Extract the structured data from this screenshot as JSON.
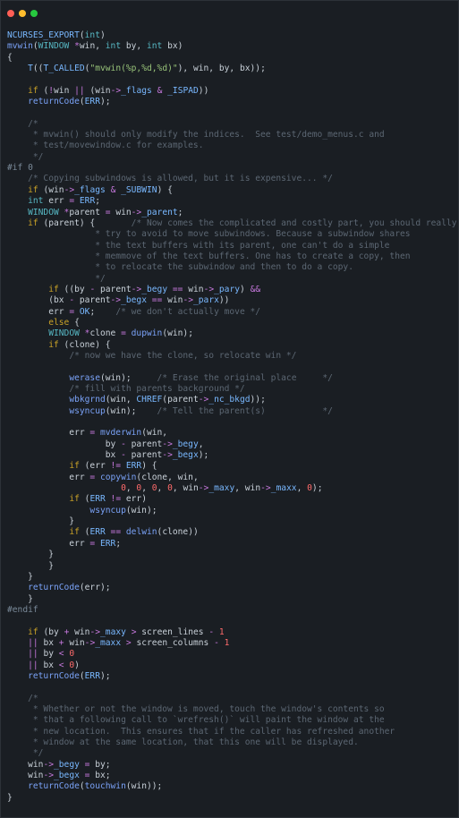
{
  "window": {
    "controls": [
      {
        "name": "close",
        "color": "#ff5f56"
      },
      {
        "name": "minimize",
        "color": "#ffbd2e"
      },
      {
        "name": "zoom",
        "color": "#27c93f"
      }
    ]
  },
  "code_lines": [
    [
      [
        "m",
        "NCURSES_EXPORT"
      ],
      [
        "d",
        "("
      ],
      [
        "t",
        "int"
      ],
      [
        "d",
        ")"
      ]
    ],
    [
      [
        "f",
        "mvwin"
      ],
      [
        "d",
        "("
      ],
      [
        "t",
        "WINDOW"
      ],
      [
        "d",
        " "
      ],
      [
        "o",
        "*"
      ],
      [
        "d",
        "win, "
      ],
      [
        "t",
        "int"
      ],
      [
        "d",
        " by, "
      ],
      [
        "t",
        "int"
      ],
      [
        "d",
        " bx)"
      ]
    ],
    [
      [
        "d",
        "{"
      ]
    ],
    [
      [
        "d",
        "    "
      ],
      [
        "m",
        "T"
      ],
      [
        "d",
        "(("
      ],
      [
        "m",
        "T_CALLED"
      ],
      [
        "d",
        "("
      ],
      [
        "s",
        "\"mvwin(%p,%d,%d)\""
      ],
      [
        "d",
        "), win, by, bx));"
      ]
    ],
    [
      [
        "d",
        ""
      ]
    ],
    [
      [
        "d",
        "    "
      ],
      [
        "k",
        "if"
      ],
      [
        "d",
        " ("
      ],
      [
        "o",
        "!"
      ],
      [
        "d",
        "win "
      ],
      [
        "o",
        "||"
      ],
      [
        "d",
        " (win"
      ],
      [
        "o",
        "->"
      ],
      [
        "v",
        "_flags"
      ],
      [
        "d",
        " "
      ],
      [
        "o",
        "&"
      ],
      [
        "d",
        " "
      ],
      [
        "m",
        "_ISPAD"
      ],
      [
        "d",
        "))"
      ]
    ],
    [
      [
        "d",
        "    "
      ],
      [
        "f",
        "returnCode"
      ],
      [
        "d",
        "("
      ],
      [
        "m",
        "ERR"
      ],
      [
        "d",
        ");"
      ]
    ],
    [
      [
        "d",
        ""
      ]
    ],
    [
      [
        "d",
        "    "
      ],
      [
        "c",
        "/*"
      ]
    ],
    [
      [
        "c",
        "     * mvwin() should only modify the indices.  See test/demo_menus.c and"
      ]
    ],
    [
      [
        "c",
        "     * test/movewindow.c for examples."
      ]
    ],
    [
      [
        "c",
        "     */"
      ]
    ],
    [
      [
        "p",
        "#if 0"
      ]
    ],
    [
      [
        "d",
        "    "
      ],
      [
        "c",
        "/* Copying subwindows is allowed, but it is expensive... */"
      ]
    ],
    [
      [
        "d",
        "    "
      ],
      [
        "k",
        "if"
      ],
      [
        "d",
        " (win"
      ],
      [
        "o",
        "->"
      ],
      [
        "v",
        "_flags"
      ],
      [
        "d",
        " "
      ],
      [
        "o",
        "&"
      ],
      [
        "d",
        " "
      ],
      [
        "m",
        "_SUBWIN"
      ],
      [
        "d",
        ") {"
      ]
    ],
    [
      [
        "d",
        "    "
      ],
      [
        "t",
        "int"
      ],
      [
        "d",
        " err "
      ],
      [
        "o",
        "="
      ],
      [
        "d",
        " "
      ],
      [
        "m",
        "ERR"
      ],
      [
        "d",
        ";"
      ]
    ],
    [
      [
        "d",
        "    "
      ],
      [
        "t",
        "WINDOW"
      ],
      [
        "d",
        " "
      ],
      [
        "o",
        "*"
      ],
      [
        "d",
        "parent "
      ],
      [
        "o",
        "="
      ],
      [
        "d",
        " win"
      ],
      [
        "o",
        "->"
      ],
      [
        "v",
        "_parent"
      ],
      [
        "d",
        ";"
      ]
    ],
    [
      [
        "d",
        "    "
      ],
      [
        "k",
        "if"
      ],
      [
        "d",
        " (parent) {       "
      ],
      [
        "c",
        "/* Now comes the complicated and costly part, you should really"
      ]
    ],
    [
      [
        "c",
        "                 * try to avoid to move subwindows. Because a subwindow shares"
      ]
    ],
    [
      [
        "c",
        "                 * the text buffers with its parent, one can't do a simple"
      ]
    ],
    [
      [
        "c",
        "                 * memmove of the text buffers. One has to create a copy, then"
      ]
    ],
    [
      [
        "c",
        "                 * to relocate the subwindow and then to do a copy."
      ]
    ],
    [
      [
        "c",
        "                 */"
      ]
    ],
    [
      [
        "d",
        "        "
      ],
      [
        "k",
        "if"
      ],
      [
        "d",
        " ((by "
      ],
      [
        "o",
        "-"
      ],
      [
        "d",
        " parent"
      ],
      [
        "o",
        "->"
      ],
      [
        "v",
        "_begy"
      ],
      [
        "d",
        " "
      ],
      [
        "o",
        "=="
      ],
      [
        "d",
        " win"
      ],
      [
        "o",
        "->"
      ],
      [
        "v",
        "_pary"
      ],
      [
        "d",
        ") "
      ],
      [
        "o",
        "&&"
      ]
    ],
    [
      [
        "d",
        "        (bx "
      ],
      [
        "o",
        "-"
      ],
      [
        "d",
        " parent"
      ],
      [
        "o",
        "->"
      ],
      [
        "v",
        "_begx"
      ],
      [
        "d",
        " "
      ],
      [
        "o",
        "=="
      ],
      [
        "d",
        " win"
      ],
      [
        "o",
        "->"
      ],
      [
        "v",
        "_parx"
      ],
      [
        "d",
        "))"
      ]
    ],
    [
      [
        "d",
        "        err "
      ],
      [
        "o",
        "="
      ],
      [
        "d",
        " "
      ],
      [
        "m",
        "OK"
      ],
      [
        "d",
        ";    "
      ],
      [
        "c",
        "/* we don't actually move */"
      ]
    ],
    [
      [
        "d",
        "        "
      ],
      [
        "k",
        "else"
      ],
      [
        "d",
        " {"
      ]
    ],
    [
      [
        "d",
        "        "
      ],
      [
        "t",
        "WINDOW"
      ],
      [
        "d",
        " "
      ],
      [
        "o",
        "*"
      ],
      [
        "d",
        "clone "
      ],
      [
        "o",
        "="
      ],
      [
        "d",
        " "
      ],
      [
        "f",
        "dupwin"
      ],
      [
        "d",
        "(win);"
      ]
    ],
    [
      [
        "d",
        "        "
      ],
      [
        "k",
        "if"
      ],
      [
        "d",
        " (clone) {"
      ]
    ],
    [
      [
        "d",
        "            "
      ],
      [
        "c",
        "/* now we have the clone, so relocate win */"
      ]
    ],
    [
      [
        "d",
        ""
      ]
    ],
    [
      [
        "d",
        "            "
      ],
      [
        "f",
        "werase"
      ],
      [
        "d",
        "(win);     "
      ],
      [
        "c",
        "/* Erase the original place     */"
      ]
    ],
    [
      [
        "d",
        "            "
      ],
      [
        "c",
        "/* fill with parents background */"
      ]
    ],
    [
      [
        "d",
        "            "
      ],
      [
        "f",
        "wbkgrnd"
      ],
      [
        "d",
        "(win, "
      ],
      [
        "m",
        "CHREF"
      ],
      [
        "d",
        "(parent"
      ],
      [
        "o",
        "->"
      ],
      [
        "v",
        "_nc_bkgd"
      ],
      [
        "d",
        "));"
      ]
    ],
    [
      [
        "d",
        "            "
      ],
      [
        "f",
        "wsyncup"
      ],
      [
        "d",
        "(win);    "
      ],
      [
        "c",
        "/* Tell the parent(s)           */"
      ]
    ],
    [
      [
        "d",
        ""
      ]
    ],
    [
      [
        "d",
        "            err "
      ],
      [
        "o",
        "="
      ],
      [
        "d",
        " "
      ],
      [
        "f",
        "mvderwin"
      ],
      [
        "d",
        "(win,"
      ]
    ],
    [
      [
        "d",
        "                   by "
      ],
      [
        "o",
        "-"
      ],
      [
        "d",
        " parent"
      ],
      [
        "o",
        "->"
      ],
      [
        "v",
        "_begy"
      ],
      [
        "d",
        ","
      ]
    ],
    [
      [
        "d",
        "                   bx "
      ],
      [
        "o",
        "-"
      ],
      [
        "d",
        " parent"
      ],
      [
        "o",
        "->"
      ],
      [
        "v",
        "_begx"
      ],
      [
        "d",
        ");"
      ]
    ],
    [
      [
        "d",
        "            "
      ],
      [
        "k",
        "if"
      ],
      [
        "d",
        " (err "
      ],
      [
        "o",
        "!="
      ],
      [
        "d",
        " "
      ],
      [
        "m",
        "ERR"
      ],
      [
        "d",
        ") {"
      ]
    ],
    [
      [
        "d",
        "            err "
      ],
      [
        "o",
        "="
      ],
      [
        "d",
        " "
      ],
      [
        "f",
        "copywin"
      ],
      [
        "d",
        "(clone, win,"
      ]
    ],
    [
      [
        "d",
        "                      "
      ],
      [
        "n",
        "0"
      ],
      [
        "d",
        ", "
      ],
      [
        "n",
        "0"
      ],
      [
        "d",
        ", "
      ],
      [
        "n",
        "0"
      ],
      [
        "d",
        ", "
      ],
      [
        "n",
        "0"
      ],
      [
        "d",
        ", win"
      ],
      [
        "o",
        "->"
      ],
      [
        "v",
        "_maxy"
      ],
      [
        "d",
        ", win"
      ],
      [
        "o",
        "->"
      ],
      [
        "v",
        "_maxx"
      ],
      [
        "d",
        ", "
      ],
      [
        "n",
        "0"
      ],
      [
        "d",
        ");"
      ]
    ],
    [
      [
        "d",
        "            "
      ],
      [
        "k",
        "if"
      ],
      [
        "d",
        " ("
      ],
      [
        "m",
        "ERR"
      ],
      [
        "d",
        " "
      ],
      [
        "o",
        "!="
      ],
      [
        "d",
        " err)"
      ]
    ],
    [
      [
        "d",
        "                "
      ],
      [
        "f",
        "wsyncup"
      ],
      [
        "d",
        "(win);"
      ]
    ],
    [
      [
        "d",
        "            }"
      ]
    ],
    [
      [
        "d",
        "            "
      ],
      [
        "k",
        "if"
      ],
      [
        "d",
        " ("
      ],
      [
        "m",
        "ERR"
      ],
      [
        "d",
        " "
      ],
      [
        "o",
        "=="
      ],
      [
        "d",
        " "
      ],
      [
        "f",
        "delwin"
      ],
      [
        "d",
        "(clone))"
      ]
    ],
    [
      [
        "d",
        "            err "
      ],
      [
        "o",
        "="
      ],
      [
        "d",
        " "
      ],
      [
        "m",
        "ERR"
      ],
      [
        "d",
        ";"
      ]
    ],
    [
      [
        "d",
        "        }"
      ]
    ],
    [
      [
        "d",
        "        }"
      ]
    ],
    [
      [
        "d",
        "    }"
      ]
    ],
    [
      [
        "d",
        "    "
      ],
      [
        "f",
        "returnCode"
      ],
      [
        "d",
        "(err);"
      ]
    ],
    [
      [
        "d",
        "    }"
      ]
    ],
    [
      [
        "p",
        "#endif"
      ]
    ],
    [
      [
        "d",
        ""
      ]
    ],
    [
      [
        "d",
        "    "
      ],
      [
        "k",
        "if"
      ],
      [
        "d",
        " (by "
      ],
      [
        "o",
        "+"
      ],
      [
        "d",
        " win"
      ],
      [
        "o",
        "->"
      ],
      [
        "v",
        "_maxy"
      ],
      [
        "d",
        " "
      ],
      [
        "o",
        ">"
      ],
      [
        "d",
        " screen_lines "
      ],
      [
        "o",
        "-"
      ],
      [
        "d",
        " "
      ],
      [
        "n",
        "1"
      ]
    ],
    [
      [
        "d",
        "    "
      ],
      [
        "o",
        "||"
      ],
      [
        "d",
        " bx "
      ],
      [
        "o",
        "+"
      ],
      [
        "d",
        " win"
      ],
      [
        "o",
        "->"
      ],
      [
        "v",
        "_maxx"
      ],
      [
        "d",
        " "
      ],
      [
        "o",
        ">"
      ],
      [
        "d",
        " screen_columns "
      ],
      [
        "o",
        "-"
      ],
      [
        "d",
        " "
      ],
      [
        "n",
        "1"
      ]
    ],
    [
      [
        "d",
        "    "
      ],
      [
        "o",
        "||"
      ],
      [
        "d",
        " by "
      ],
      [
        "o",
        "<"
      ],
      [
        "d",
        " "
      ],
      [
        "n",
        "0"
      ]
    ],
    [
      [
        "d",
        "    "
      ],
      [
        "o",
        "||"
      ],
      [
        "d",
        " bx "
      ],
      [
        "o",
        "<"
      ],
      [
        "d",
        " "
      ],
      [
        "n",
        "0"
      ],
      [
        "d",
        ")"
      ]
    ],
    [
      [
        "d",
        "    "
      ],
      [
        "f",
        "returnCode"
      ],
      [
        "d",
        "("
      ],
      [
        "m",
        "ERR"
      ],
      [
        "d",
        ");"
      ]
    ],
    [
      [
        "d",
        ""
      ]
    ],
    [
      [
        "d",
        "    "
      ],
      [
        "c",
        "/*"
      ]
    ],
    [
      [
        "c",
        "     * Whether or not the window is moved, touch the window's contents so"
      ]
    ],
    [
      [
        "c",
        "     * that a following call to `wrefresh()` will paint the window at the"
      ]
    ],
    [
      [
        "c",
        "     * new location.  This ensures that if the caller has refreshed another"
      ]
    ],
    [
      [
        "c",
        "     * window at the same location, that this one will be displayed."
      ]
    ],
    [
      [
        "c",
        "     */"
      ]
    ],
    [
      [
        "d",
        "    win"
      ],
      [
        "o",
        "->"
      ],
      [
        "v",
        "_begy"
      ],
      [
        "d",
        " "
      ],
      [
        "o",
        "="
      ],
      [
        "d",
        " by;"
      ]
    ],
    [
      [
        "d",
        "    win"
      ],
      [
        "o",
        "->"
      ],
      [
        "v",
        "_begx"
      ],
      [
        "d",
        " "
      ],
      [
        "o",
        "="
      ],
      [
        "d",
        " bx;"
      ]
    ],
    [
      [
        "d",
        "    "
      ],
      [
        "f",
        "returnCode"
      ],
      [
        "d",
        "("
      ],
      [
        "f",
        "touchwin"
      ],
      [
        "d",
        "(win));"
      ]
    ],
    [
      [
        "d",
        "}"
      ]
    ]
  ]
}
